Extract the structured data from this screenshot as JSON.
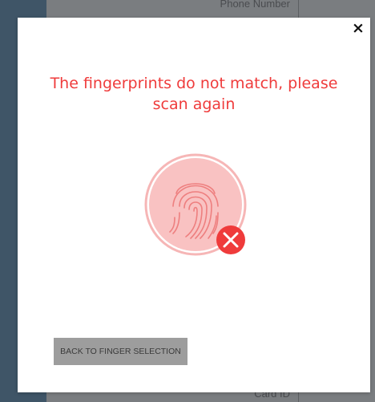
{
  "background": {
    "field_top_label": "Phone Number",
    "field_bottom_label": "Card ID"
  },
  "dialog": {
    "close_glyph": "×",
    "message": "The fingerprints do not match, please scan again",
    "status_icon": "fingerprint-icon",
    "error_icon": "error-x-icon",
    "back_button_label": "BACK TO FINGER SELECTION",
    "colors": {
      "error": "#ef3b3b",
      "fingerprint_fill": "#f9c2c2",
      "button_bg": "#9d9d9d"
    }
  }
}
